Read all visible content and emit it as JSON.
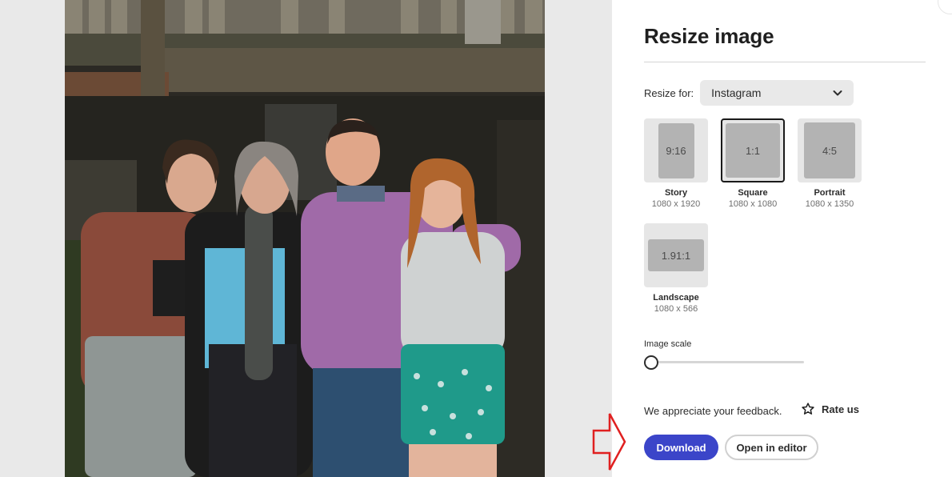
{
  "panel": {
    "title": "Resize image",
    "resize_for_label": "Resize for:",
    "resize_for_value": "Instagram",
    "presets": [
      {
        "ratio": "9:16",
        "name": "Story",
        "size": "1080 x 1920"
      },
      {
        "ratio": "1:1",
        "name": "Square",
        "size": "1080 x 1080",
        "selected": true
      },
      {
        "ratio": "4:5",
        "name": "Portrait",
        "size": "1080 x 1350"
      },
      {
        "ratio": "1.91:1",
        "name": "Landscape",
        "size": "1080 x 566"
      }
    ],
    "image_scale_label": "Image scale",
    "image_scale_value": 0,
    "feedback_text": "We appreciate your feedback.",
    "rate_label": "Rate us",
    "download_label": "Download",
    "open_editor_label": "Open in editor"
  },
  "icons": {
    "dropdown": "chevron-down-icon",
    "rate": "star-icon",
    "annotation": "red-arrow-icon"
  },
  "colors": {
    "primary": "#3b45c9",
    "canvas_bg": "#e9e9e9",
    "annotation_arrow": "#e02020"
  }
}
